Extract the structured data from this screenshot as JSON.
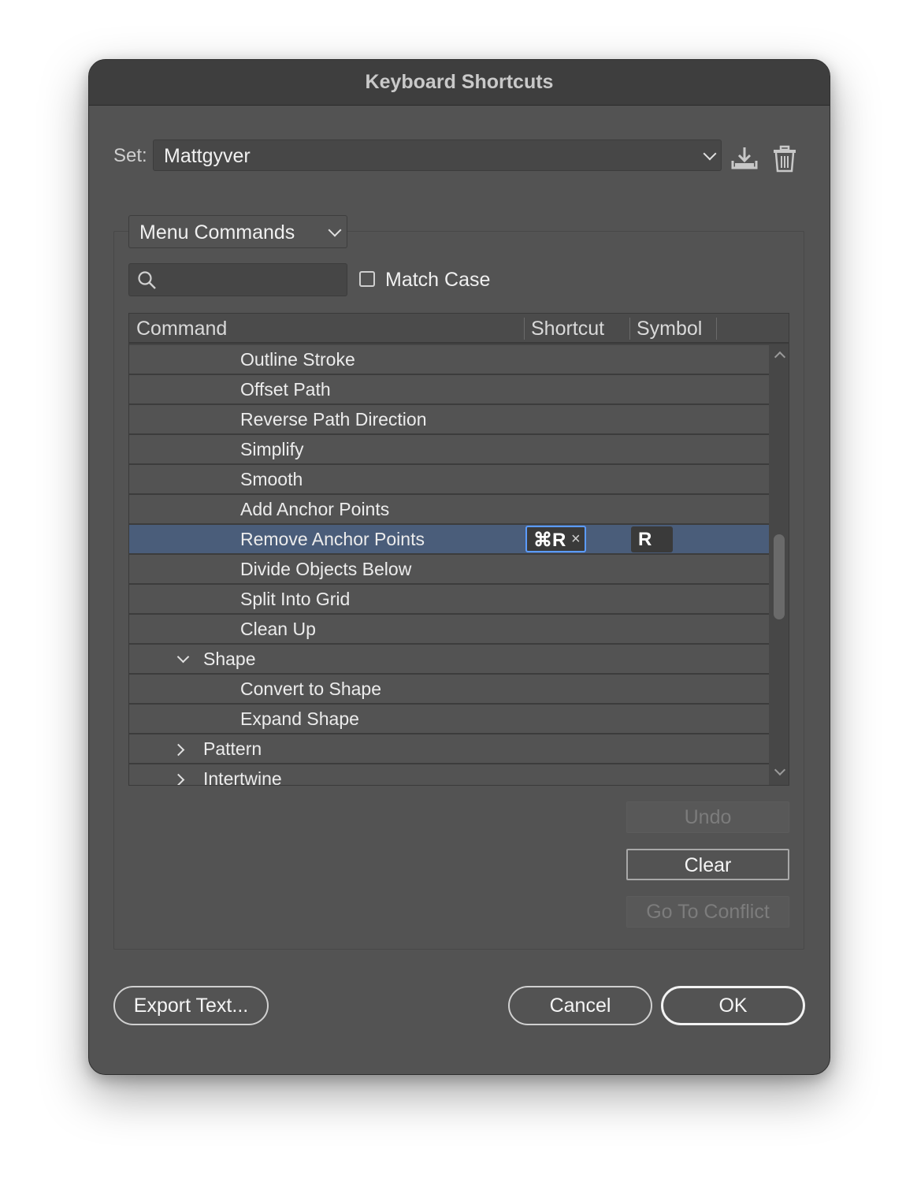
{
  "window": {
    "title": "Keyboard Shortcuts"
  },
  "set": {
    "label": "Set:",
    "value": "Mattgyver"
  },
  "category": {
    "value": "Menu Commands"
  },
  "search": {
    "value": "",
    "placeholder": ""
  },
  "match_case": {
    "label": "Match Case",
    "checked": false
  },
  "table": {
    "headers": {
      "command": "Command",
      "shortcut": "Shortcut",
      "symbol": "Symbol"
    },
    "rows": [
      {
        "label": "Outline Stroke"
      },
      {
        "label": "Offset Path"
      },
      {
        "label": "Reverse Path Direction"
      },
      {
        "label": "Simplify"
      },
      {
        "label": "Smooth"
      },
      {
        "label": "Add Anchor Points"
      },
      {
        "label": "Remove Anchor Points",
        "shortcut": "⌘R",
        "remove": "×",
        "symbol": "R",
        "selected": true
      },
      {
        "label": "Divide Objects Below"
      },
      {
        "label": "Split Into Grid"
      },
      {
        "label": "Clean Up"
      },
      {
        "label": "Shape",
        "group": true,
        "expanded": true
      },
      {
        "label": "Convert to Shape"
      },
      {
        "label": "Expand Shape"
      },
      {
        "label": "Pattern",
        "group": true,
        "expanded": false
      },
      {
        "label": "Intertwine",
        "group": true,
        "expanded": false
      }
    ]
  },
  "buttons": {
    "undo": "Undo",
    "clear": "Clear",
    "go_to_conflict": "Go To Conflict",
    "export_text": "Export Text...",
    "cancel": "Cancel",
    "ok": "OK"
  },
  "icons": {
    "save": "download-icon",
    "delete": "trash-icon",
    "search": "search-icon"
  },
  "colors": {
    "window_bg": "#535353",
    "titlebar_bg": "#3e3e3e",
    "selection_bg": "#4a5d7a",
    "focus_border": "#5b9bff"
  }
}
